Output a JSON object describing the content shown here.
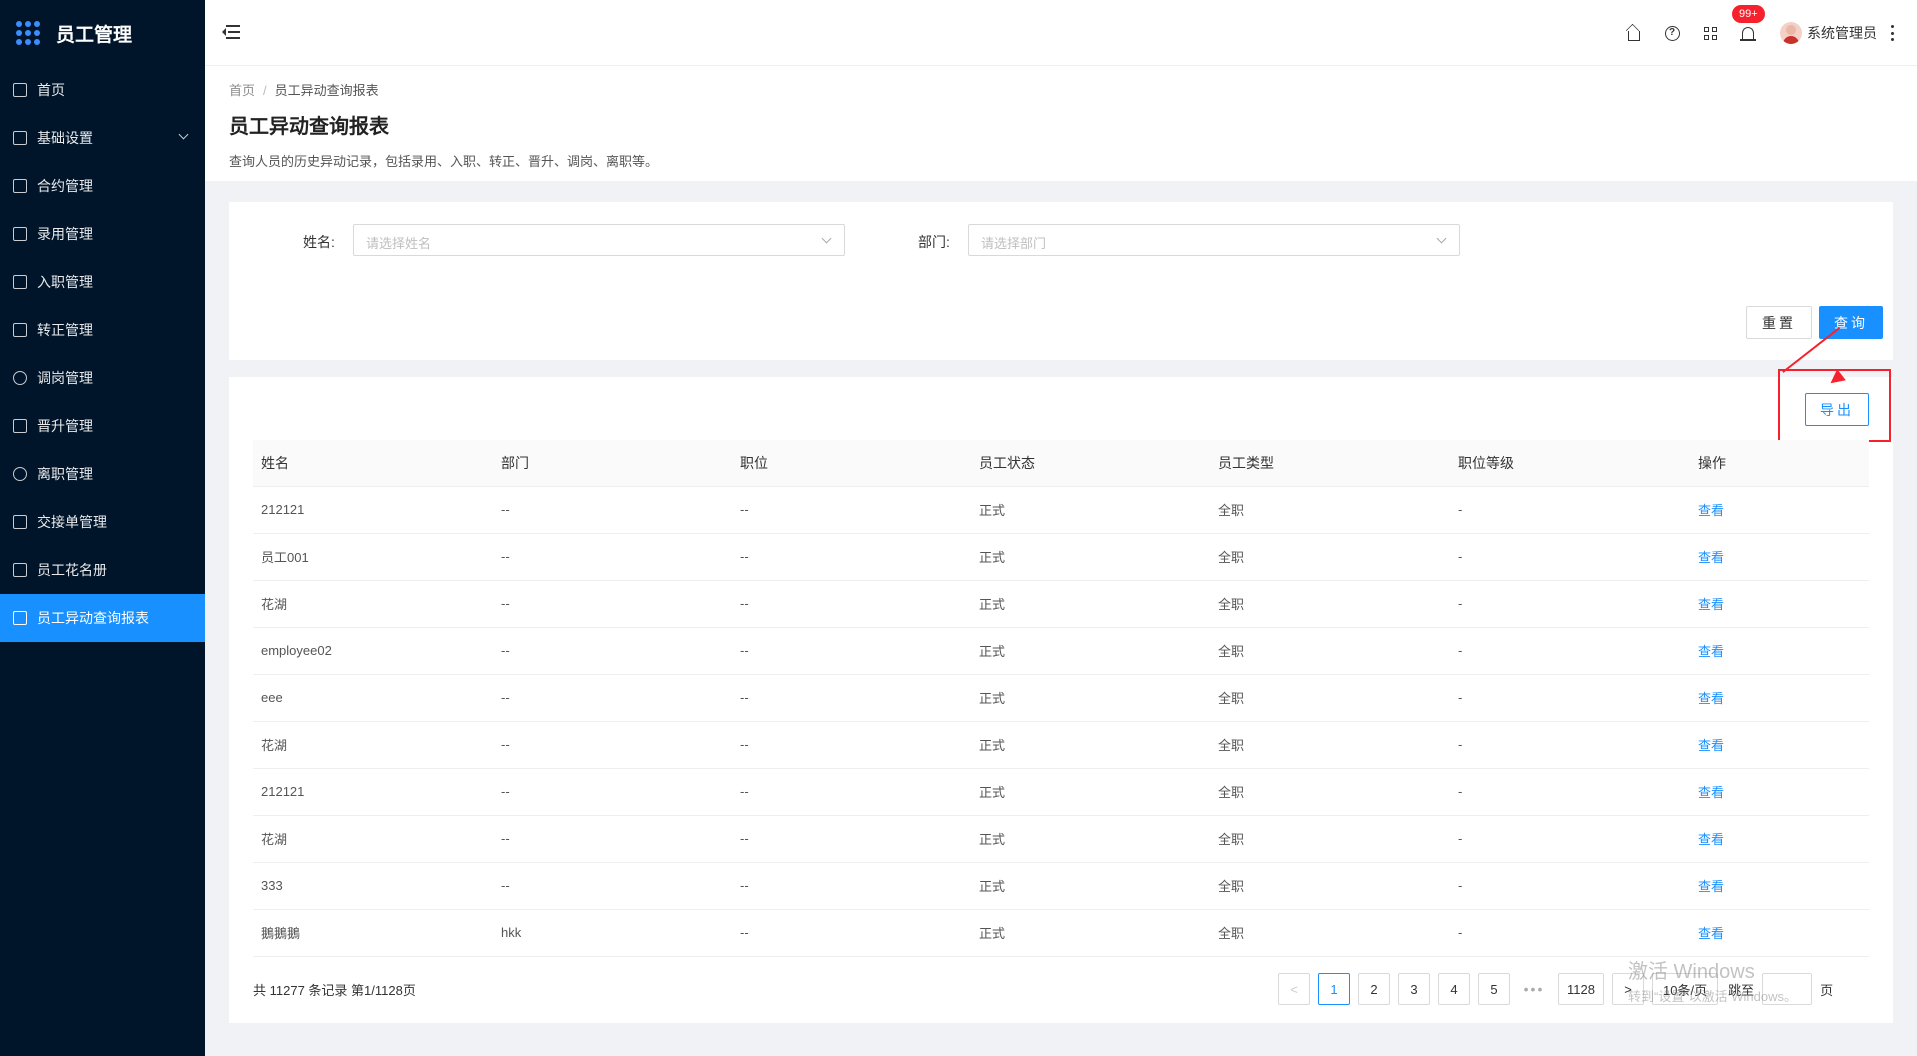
{
  "app": {
    "title": "员工管理"
  },
  "sidebar": {
    "items": [
      {
        "label": "首页",
        "icon": "home-icon"
      },
      {
        "label": "基础设置",
        "icon": "settings-icon",
        "expandable": true
      },
      {
        "label": "合约管理",
        "icon": "calendar-icon"
      },
      {
        "label": "录用管理",
        "icon": "hire-icon"
      },
      {
        "label": "入职管理",
        "icon": "onboard-icon"
      },
      {
        "label": "转正管理",
        "icon": "regular-icon"
      },
      {
        "label": "调岗管理",
        "icon": "user-icon"
      },
      {
        "label": "晋升管理",
        "icon": "promotion-icon"
      },
      {
        "label": "离职管理",
        "icon": "leave-icon"
      },
      {
        "label": "交接单管理",
        "icon": "handover-icon"
      },
      {
        "label": "员工花名册",
        "icon": "roster-icon"
      },
      {
        "label": "员工异动查询报表",
        "icon": "report-icon",
        "active": true
      }
    ]
  },
  "header": {
    "notification_count": "99+",
    "user_name": "系统管理员"
  },
  "breadcrumb": {
    "home": "首页",
    "current": "员工异动查询报表"
  },
  "page": {
    "title": "员工异动查询报表",
    "description": "查询人员的历史异动记录，包括录用、入职、转正、晋升、调岗、离职等。"
  },
  "search": {
    "name_label": "姓名:",
    "name_placeholder": "请选择姓名",
    "dept_label": "部门:",
    "dept_placeholder": "请选择部门",
    "reset_label": "重置",
    "query_label": "查询"
  },
  "toolbar": {
    "export_label": "导出"
  },
  "table": {
    "columns": [
      "姓名",
      "部门",
      "职位",
      "员工状态",
      "员工类型",
      "职位等级",
      "操作"
    ],
    "rows": [
      [
        "212121",
        "--",
        "--",
        "正式",
        "全职",
        "-",
        "查看"
      ],
      [
        "员工001",
        "--",
        "--",
        "正式",
        "全职",
        "-",
        "查看"
      ],
      [
        "花湖",
        "--",
        "--",
        "正式",
        "全职",
        "-",
        "查看"
      ],
      [
        "employee02",
        "--",
        "--",
        "正式",
        "全职",
        "-",
        "查看"
      ],
      [
        "eee",
        "--",
        "--",
        "正式",
        "全职",
        "-",
        "查看"
      ],
      [
        "花湖",
        "--",
        "--",
        "正式",
        "全职",
        "-",
        "查看"
      ],
      [
        "212121",
        "--",
        "--",
        "正式",
        "全职",
        "-",
        "查看"
      ],
      [
        "花湖",
        "--",
        "--",
        "正式",
        "全职",
        "-",
        "查看"
      ],
      [
        "333",
        "--",
        "--",
        "正式",
        "全职",
        "-",
        "查看"
      ],
      [
        "鵝鵝鵝",
        "hkk",
        "--",
        "正式",
        "全职",
        "-",
        "查看"
      ]
    ]
  },
  "pagination": {
    "total_text": "共 11277 条记录 第1/1128页",
    "pages": [
      "1",
      "2",
      "3",
      "4",
      "5"
    ],
    "dots": "•••",
    "last_page": "1128",
    "page_size": "10条/页",
    "jump_label": "跳至",
    "page_suffix": "页"
  },
  "watermark": {
    "line1": "激活 Windows",
    "line2": "转到“设置”以激活 Windows。"
  },
  "colors": {
    "sidebar_bg": "#001529",
    "primary": "#1890ff",
    "highlight": "#f5222d"
  }
}
